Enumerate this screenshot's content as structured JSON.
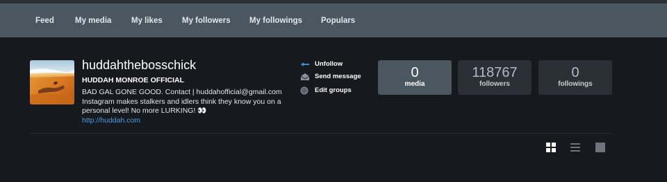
{
  "nav": {
    "items": [
      {
        "label": "Feed"
      },
      {
        "label": "My media"
      },
      {
        "label": "My likes"
      },
      {
        "label": "My followers"
      },
      {
        "label": "My followings"
      },
      {
        "label": "Populars"
      }
    ]
  },
  "profile": {
    "username": "huddahthebosschick",
    "full_name": "HUDDAH MONROE OFFICIAL",
    "bio_text": "BAD GAL GONE GOOD. Contact | huddahofficial@gmail.com Instagram makes stalkers and idlers think they know you on a personal level! No more LURKING!",
    "bio_emoji": "👀",
    "website": "http://huddah.com"
  },
  "actions": {
    "unfollow": "Unfollow",
    "send_message": "Send message",
    "edit_groups": "Edit groups"
  },
  "stats": [
    {
      "value": "0",
      "label": "media",
      "active": true
    },
    {
      "value": "118767",
      "label": "followers",
      "active": false
    },
    {
      "value": "0",
      "label": "followings",
      "active": false
    }
  ],
  "view_modes": [
    {
      "icon": "grid-view-icon",
      "active": true
    },
    {
      "icon": "list-view-icon",
      "active": false
    },
    {
      "icon": "single-view-icon",
      "active": false
    }
  ],
  "colors": {
    "background": "#16191d",
    "navbar": "#4a5660",
    "stat_box": "#2a3036",
    "link": "#4a9fe0",
    "accent_arrow": "#3a8fd8"
  }
}
